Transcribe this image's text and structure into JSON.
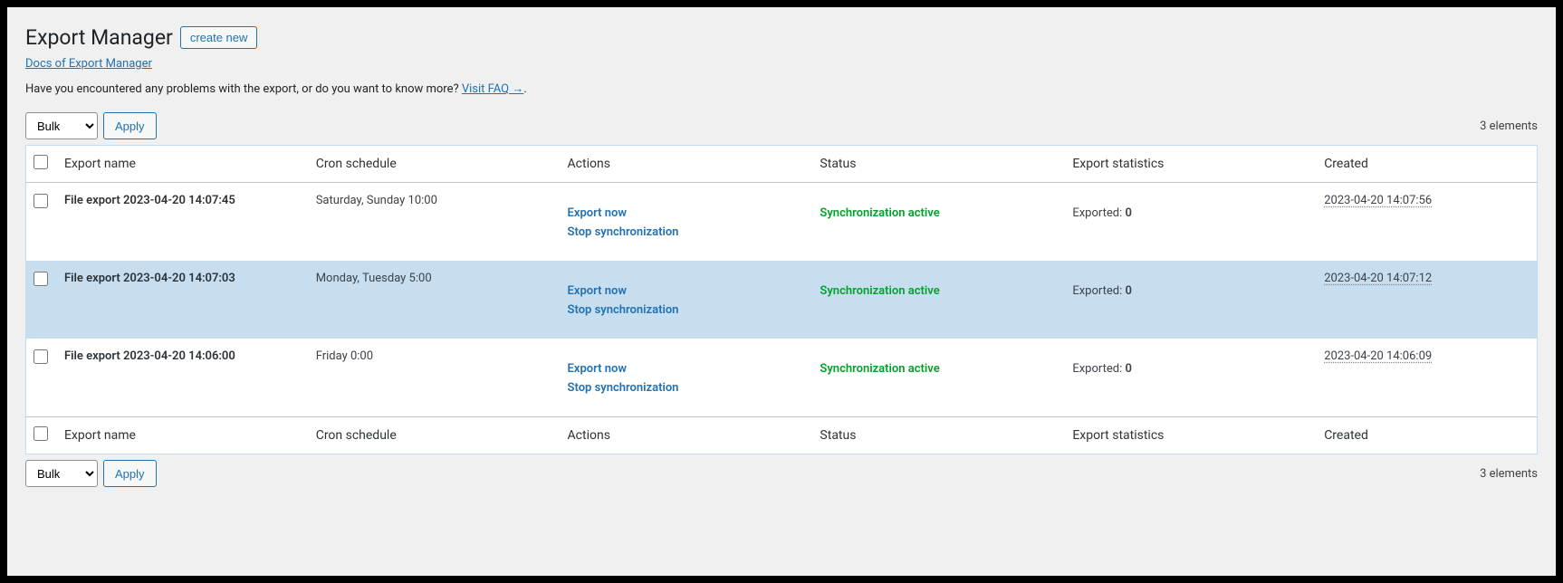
{
  "header": {
    "title": "Export Manager",
    "create_label": "create new",
    "docs_link": "Docs of Export Manager",
    "faq_text": "Have you encountered any problems with the export, or do you want to know more? ",
    "faq_link": "Visit FAQ →",
    "faq_period": "."
  },
  "toolbar": {
    "bulk_label": "Bulk",
    "apply_label": "Apply",
    "count_label": "3 elements"
  },
  "columns": {
    "name": "Export name",
    "cron": "Cron schedule",
    "actions": "Actions",
    "status": "Status",
    "stats": "Export statistics",
    "created": "Created"
  },
  "action_labels": {
    "export_now": "Export now",
    "stop_sync": "Stop synchronization"
  },
  "stats_label": "Exported: ",
  "rows": [
    {
      "name": "File export 2023-04-20 14:07:45",
      "cron": "Saturday, Sunday 10:00",
      "status": "Synchronization active",
      "exported": "0",
      "created": "2023-04-20 14:07:56",
      "highlight": false
    },
    {
      "name": "File export 2023-04-20 14:07:03",
      "cron": "Monday, Tuesday 5:00",
      "status": "Synchronization active",
      "exported": "0",
      "created": "2023-04-20 14:07:12",
      "highlight": true
    },
    {
      "name": "File export 2023-04-20 14:06:00",
      "cron": "Friday 0:00",
      "status": "Synchronization active",
      "exported": "0",
      "created": "2023-04-20 14:06:09",
      "highlight": false
    }
  ]
}
